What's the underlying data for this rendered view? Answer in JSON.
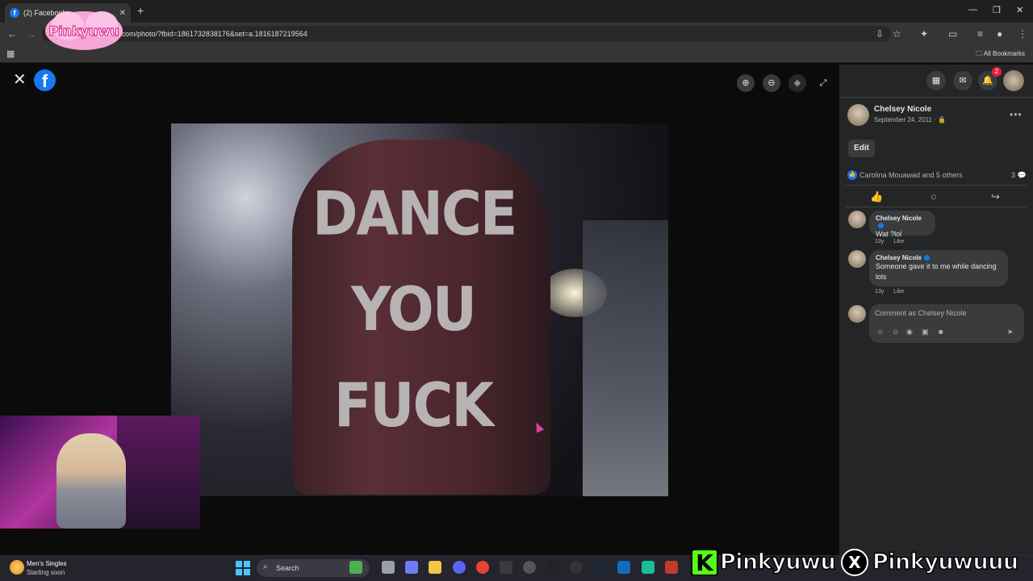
{
  "browser": {
    "tab_title": "(2) Facebook",
    "tab_favicon": "f",
    "new_tab": "+",
    "url": ".com/photo/?fbid=1861732838176&set=a.1816187219564",
    "all_bookmarks": "All Bookmarks",
    "window_controls": [
      "minimize",
      "restore",
      "close"
    ]
  },
  "overlay_logo": {
    "text": "Pinkyuwu"
  },
  "viewer": {
    "close_icon": "close-icon",
    "fb_logo": "f",
    "controls": [
      "zoom-in-icon",
      "zoom-out-icon",
      "tag-icon",
      "fullscreen-icon"
    ],
    "photo_text": [
      "DANCE",
      "YOU",
      "FUCK"
    ]
  },
  "sidebar": {
    "top_icons": [
      "menu-grid-icon",
      "messenger-icon",
      "notifications-icon"
    ],
    "notification_count": "2",
    "post": {
      "author": "Chelsey Nicole",
      "date": "September 24, 2011 · 🔒",
      "edit_label": "Edit",
      "reactions": "Carolina Mouawad and 5 others",
      "comment_count": "3"
    },
    "comments": [
      {
        "author": "Chelsey Nicole",
        "text": "Wat ?lol",
        "age": "13y",
        "like": "Like"
      },
      {
        "author": "Chelsey Nicole",
        "text": "Someone gave it to me while dancing lols",
        "age": "13y",
        "like": "Like"
      }
    ],
    "comment_input": {
      "placeholder": "Comment as Chelsey Nicole"
    }
  },
  "taskbar": {
    "weather_title": "Men's Singles",
    "weather_sub": "Starting soon",
    "search_label": "Search"
  },
  "social": {
    "kick_handle": "Pinkyuwu",
    "x_handle": "Pinkyuwuuu"
  },
  "colors": {
    "facebook_blue": "#1877f2",
    "kick_green": "#53fc18",
    "sidebar_bg": "#242526",
    "notification_red": "#e41e3f"
  }
}
